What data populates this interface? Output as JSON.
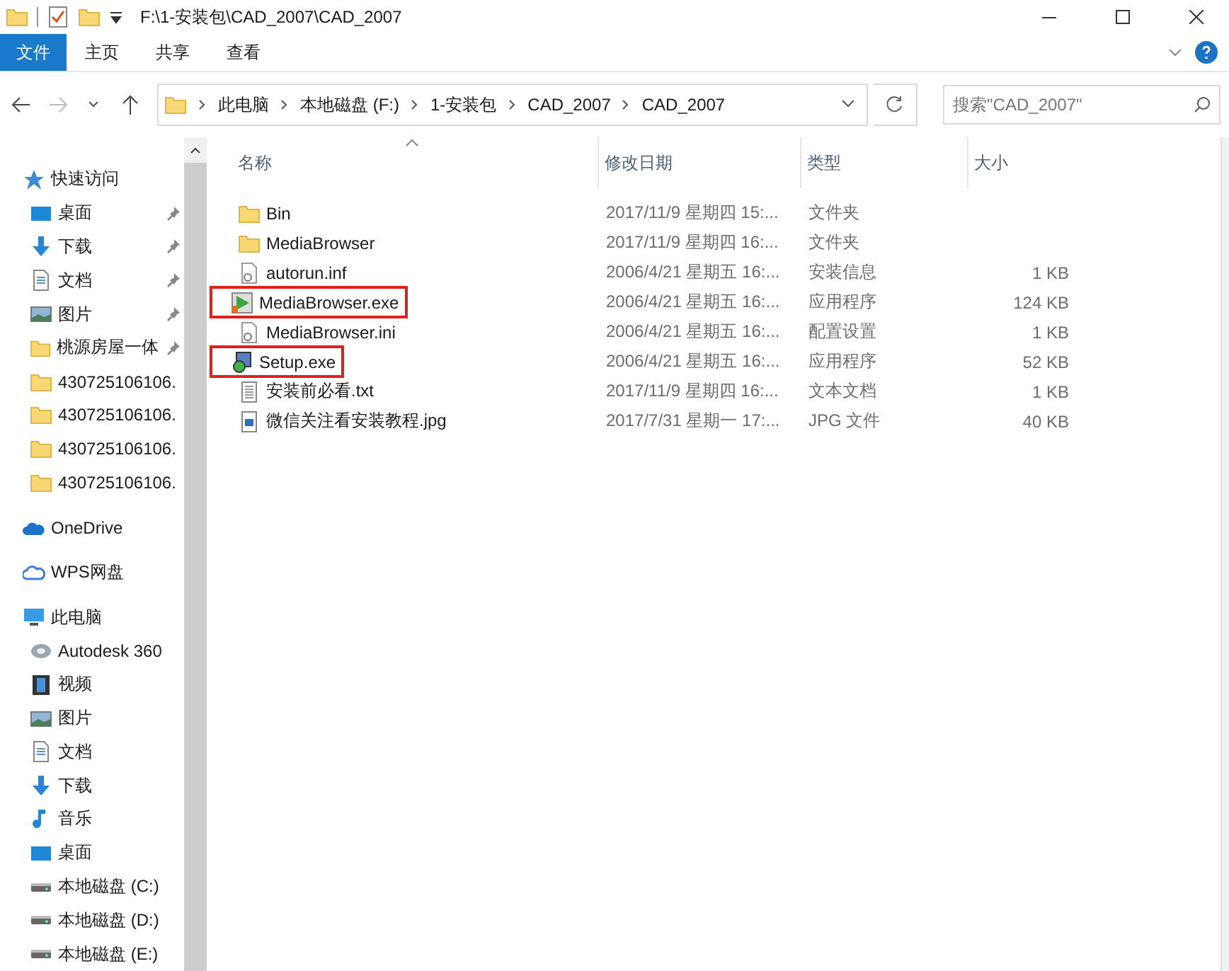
{
  "title_bar": {
    "path": "F:\\1-安装包\\CAD_2007\\CAD_2007"
  },
  "ribbon_tabs": [
    {
      "label": "文件",
      "selected": true
    },
    {
      "label": "主页",
      "selected": false
    },
    {
      "label": "共享",
      "selected": false
    },
    {
      "label": "查看",
      "selected": false
    }
  ],
  "address_bar": {
    "crumbs": [
      "此电脑",
      "本地磁盘 (F:)",
      "1-安装包",
      "CAD_2007",
      "CAD_2007"
    ]
  },
  "search": {
    "placeholder": "搜索\"CAD_2007\""
  },
  "sidebar": {
    "items": [
      {
        "label": "快速访问",
        "kind": "star",
        "pinned": false,
        "children": [
          {
            "label": "桌面",
            "kind": "desktop",
            "pinned": true
          },
          {
            "label": "下载",
            "kind": "download",
            "pinned": true
          },
          {
            "label": "文档",
            "kind": "document",
            "pinned": true
          },
          {
            "label": "图片",
            "kind": "picture",
            "pinned": true
          },
          {
            "label": "桃源房屋一体",
            "kind": "folder",
            "pinned": true
          },
          {
            "label": "430725106106.",
            "kind": "folder",
            "pinned": false
          },
          {
            "label": "430725106106.",
            "kind": "folder",
            "pinned": false
          },
          {
            "label": "430725106106.",
            "kind": "folder",
            "pinned": false
          },
          {
            "label": "430725106106.",
            "kind": "folder",
            "pinned": false
          }
        ]
      },
      {
        "label": "OneDrive",
        "kind": "cloud",
        "pinned": false
      },
      {
        "label": "WPS网盘",
        "kind": "cloud-outline",
        "pinned": false
      },
      {
        "label": "此电脑",
        "kind": "computer",
        "pinned": false,
        "children": [
          {
            "label": "Autodesk 360",
            "kind": "disc",
            "pinned": false
          },
          {
            "label": "视频",
            "kind": "video",
            "pinned": false
          },
          {
            "label": "图片",
            "kind": "picture",
            "pinned": false
          },
          {
            "label": "文档",
            "kind": "document",
            "pinned": false
          },
          {
            "label": "下载",
            "kind": "download",
            "pinned": false
          },
          {
            "label": "音乐",
            "kind": "music",
            "pinned": false
          },
          {
            "label": "桌面",
            "kind": "desktop",
            "pinned": false
          },
          {
            "label": "本地磁盘 (C:)",
            "kind": "drive",
            "pinned": false
          },
          {
            "label": "本地磁盘 (D:)",
            "kind": "drive",
            "pinned": false
          },
          {
            "label": "本地磁盘 (E:)",
            "kind": "drive",
            "pinned": false
          }
        ]
      }
    ]
  },
  "table": {
    "columns": [
      "名称",
      "修改日期",
      "类型",
      "大小"
    ],
    "rows": [
      {
        "kind": "folder",
        "name": "Bin",
        "date": "2017/11/9 星期四 15:...",
        "type": "文件夹",
        "size": "",
        "highlighted": false
      },
      {
        "kind": "folder",
        "name": "MediaBrowser",
        "date": "2017/11/9 星期四 16:...",
        "type": "文件夹",
        "size": "",
        "highlighted": false
      },
      {
        "kind": "settings",
        "name": "autorun.inf",
        "date": "2006/4/21 星期五 16:...",
        "type": "安装信息",
        "size": "1 KB",
        "highlighted": false
      },
      {
        "kind": "player",
        "name": "MediaBrowser.exe",
        "date": "2006/4/21 星期五 16:...",
        "type": "应用程序",
        "size": "124 KB",
        "highlighted": true
      },
      {
        "kind": "settings",
        "name": "MediaBrowser.ini",
        "date": "2006/4/21 星期五 16:...",
        "type": "配置设置",
        "size": "1 KB",
        "highlighted": false
      },
      {
        "kind": "installer",
        "name": "Setup.exe",
        "date": "2006/4/21 星期五 16:...",
        "type": "应用程序",
        "size": "52 KB",
        "highlighted": true
      },
      {
        "kind": "text",
        "name": "安装前必看.txt",
        "date": "2017/11/9 星期四 16:...",
        "type": "文本文档",
        "size": "1 KB",
        "highlighted": false
      },
      {
        "kind": "image",
        "name": "微信关注看安装教程.jpg",
        "date": "2017/7/31 星期一 17:...",
        "type": "JPG 文件",
        "size": "40 KB",
        "highlighted": false
      }
    ]
  }
}
